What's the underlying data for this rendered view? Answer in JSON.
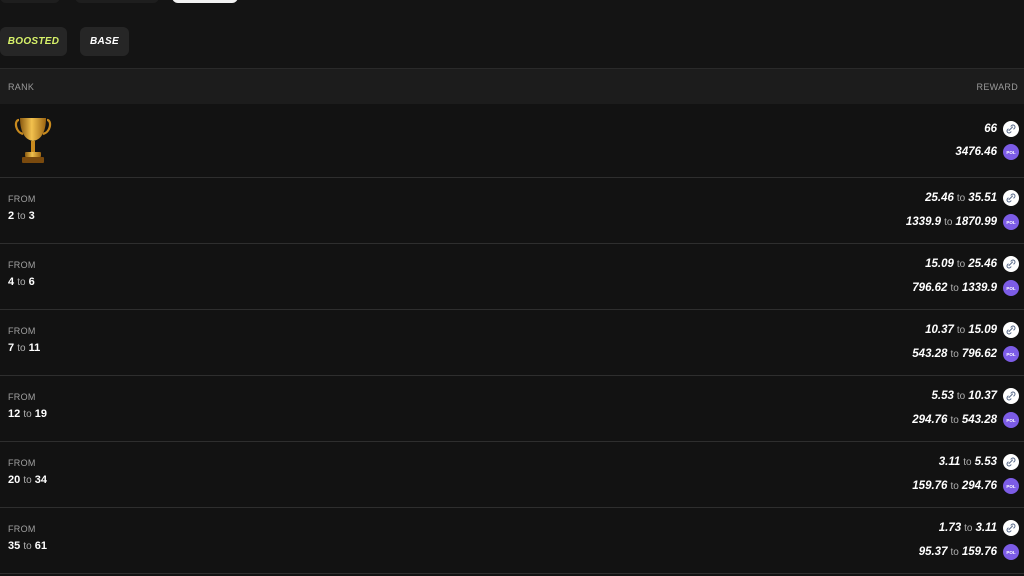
{
  "filters": {
    "boosted": "BOOSTED",
    "base": "BASE"
  },
  "table": {
    "rank_header": "RANK",
    "reward_header": "REWARD",
    "from_label": "FROM",
    "to_label": "to",
    "pol_icon_text": "POL",
    "trophy_icon": "trophy-icon",
    "rows": [
      {
        "rewards": [
          {
            "value": "66"
          },
          {
            "value": "3476.46"
          }
        ]
      },
      {
        "from": "2",
        "to": "3",
        "rewards": [
          {
            "from": "25.46",
            "to": "35.51"
          },
          {
            "from": "1339.9",
            "to": "1870.99"
          }
        ]
      },
      {
        "from": "4",
        "to": "6",
        "rewards": [
          {
            "from": "15.09",
            "to": "25.46"
          },
          {
            "from": "796.62",
            "to": "1339.9"
          }
        ]
      },
      {
        "from": "7",
        "to": "11",
        "rewards": [
          {
            "from": "10.37",
            "to": "15.09"
          },
          {
            "from": "543.28",
            "to": "796.62"
          }
        ]
      },
      {
        "from": "12",
        "to": "19",
        "rewards": [
          {
            "from": "5.53",
            "to": "10.37"
          },
          {
            "from": "294.76",
            "to": "543.28"
          }
        ]
      },
      {
        "from": "20",
        "to": "34",
        "rewards": [
          {
            "from": "3.11",
            "to": "5.53"
          },
          {
            "from": "159.76",
            "to": "294.76"
          }
        ]
      },
      {
        "from": "35",
        "to": "61",
        "rewards": [
          {
            "from": "1.73",
            "to": "3.11"
          },
          {
            "from": "95.37",
            "to": "159.76"
          }
        ]
      }
    ]
  },
  "colors": {
    "accent": "#d8f36a",
    "pol": "#7c5ce6",
    "background": "#121212"
  }
}
